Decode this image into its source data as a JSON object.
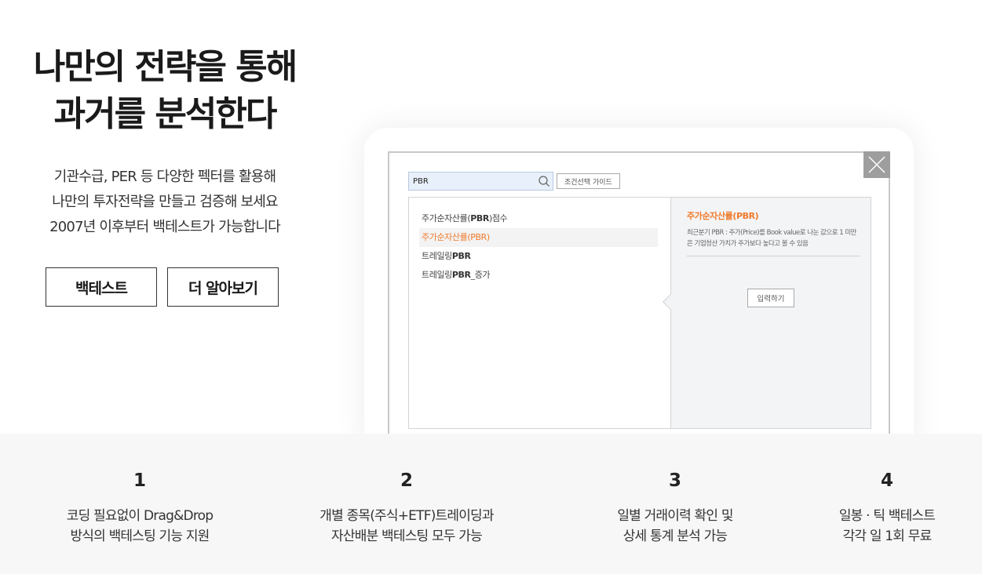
{
  "hero": {
    "title_line1": "나만의 전략을 통해",
    "title_line2": "과거를 분석한다",
    "desc_line1": "기관수급, PER 등 다양한 펙터를 활용해",
    "desc_line2": "나만의 투자전략을 만들고 검증해 보세요",
    "desc_line3": "2007년 이후부터 백테스트가 가능합니다",
    "backtest_label": "백테스트",
    "learn_more_label": "더 알아보기"
  },
  "panel": {
    "search_value": "PBR",
    "guide_label": "조건선택 가이드",
    "items": [
      {
        "prefix": "주가순자산률(",
        "bold": "PBR",
        "suffix": ")점수"
      },
      {
        "prefix": "주가순자산률(",
        "bold": "PBR",
        "suffix": ")"
      },
      {
        "prefix": "트레일링",
        "bold": "PBR",
        "suffix": ""
      },
      {
        "prefix": "트레일링",
        "bold": "PBR",
        "suffix": "_증가"
      }
    ],
    "detail_title": "주가순자산률(PBR)",
    "detail_desc": "최근분기 PBR : 주가(Price)를 Book value로 나눈 값으로 1 미만은 기업청산 가치가 주가보다 높다고 볼 수 있음",
    "input_label": "입력하기"
  },
  "features": [
    {
      "num": "1",
      "line1": "코딩 필요없이 Drag&Drop",
      "line2": "방식의 백테스팅 기능 지원"
    },
    {
      "num": "2",
      "line1": "개별 종목(주식+ETF)트레이딩과",
      "line2": "자산배분 백테스팅 모두 가능"
    },
    {
      "num": "3",
      "line1": "일별 거래이력 확인 및",
      "line2": "상세 통계 분석 가능"
    },
    {
      "num": "4",
      "line1": "일봉 · 틱 백테스트",
      "line2": "각각 일 1회 무료"
    }
  ],
  "colors": {
    "accent": "#f07a2b",
    "search_bg": "#e8f0fb",
    "close_bg": "#9e9e9e"
  }
}
